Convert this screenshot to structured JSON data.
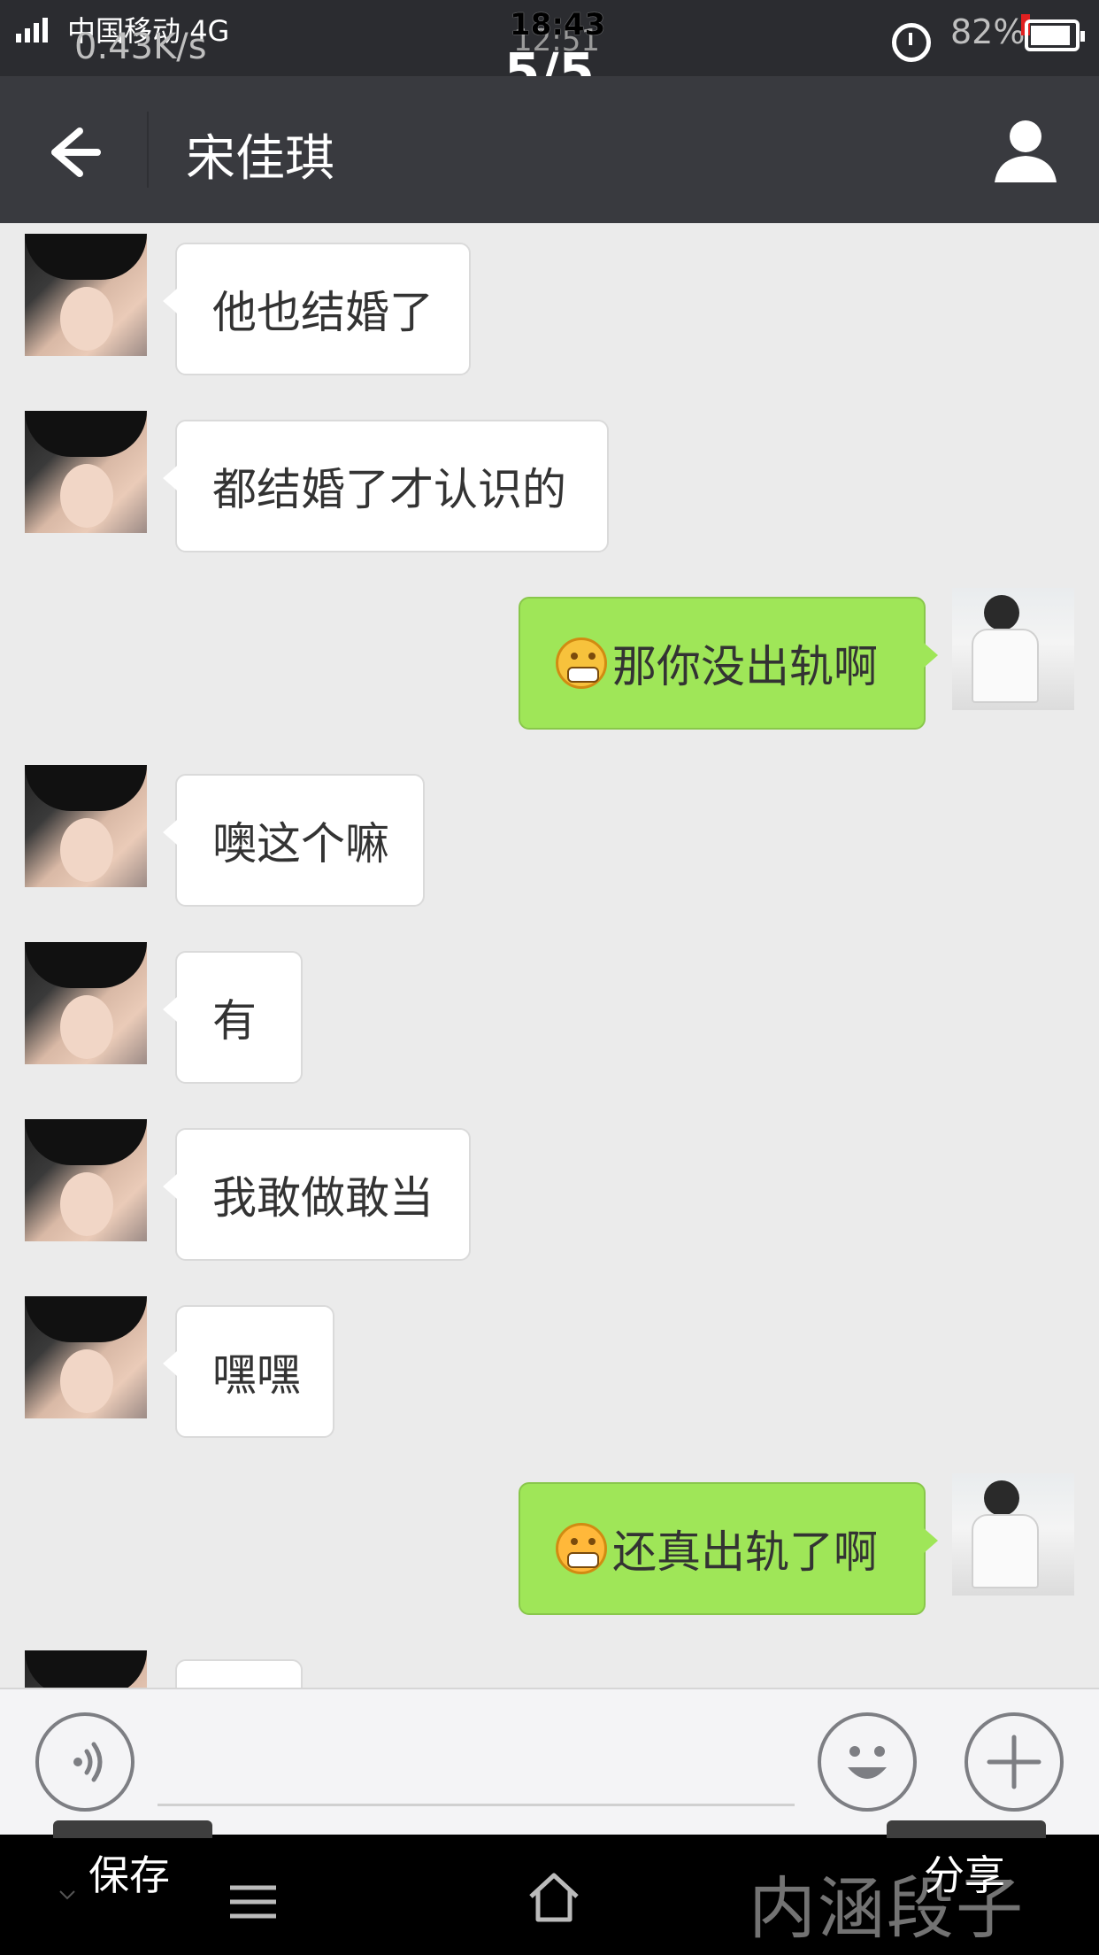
{
  "status_bar": {
    "carrier": "中国移动",
    "network": "4G",
    "net_speed": "0.43K/s",
    "time": "18:43",
    "time_ghost": "12:51",
    "battery_pct": "82%",
    "page_indicator": "5/5"
  },
  "header": {
    "title": "宋佳琪",
    "back_icon": "arrow-left-icon",
    "profile_icon": "person-icon"
  },
  "messages": [
    {
      "side": "in",
      "text": "他也结婚了"
    },
    {
      "side": "in",
      "text": "都结婚了才认识的"
    },
    {
      "side": "out",
      "emoji": "grin",
      "text": "那你没出轨啊"
    },
    {
      "side": "in",
      "text": "噢这个嘛"
    },
    {
      "side": "in",
      "text": "有"
    },
    {
      "side": "in",
      "text": "我敢做敢当"
    },
    {
      "side": "in",
      "text": "嘿嘿"
    },
    {
      "side": "out",
      "emoji": "awkward",
      "text": "还真出轨了啊"
    },
    {
      "side": "in",
      "text": ""
    }
  ],
  "input_bar": {
    "voice_icon": "voice-icon",
    "emoji_icon": "smiley-icon",
    "plus_icon": "plus-icon"
  },
  "bottom_bar": {
    "save_label": "保存",
    "share_label": "分享",
    "watermark": "内涵段子"
  },
  "colors": {
    "header_bg": "#393a3f",
    "chat_bg": "#ebebeb",
    "bubble_out": "#9fe658",
    "bubble_in": "#ffffff"
  }
}
